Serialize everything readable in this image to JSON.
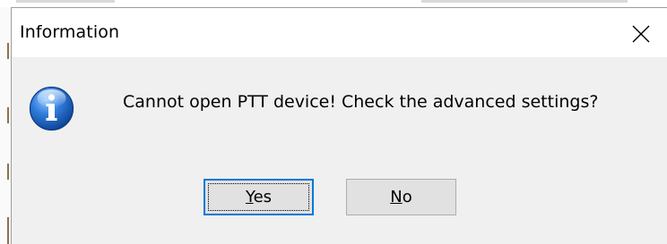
{
  "dialog": {
    "title": "Information",
    "message": "Cannot open PTT device! Check the advanced settings?",
    "icon": "information-icon",
    "buttons": {
      "yes": {
        "mnemonic": "Y",
        "rest": "es"
      },
      "no": {
        "mnemonic": "N",
        "rest": "o"
      }
    },
    "default_button": "yes"
  },
  "colors": {
    "titlebar": "#ffffff",
    "content": "#f0f0f0",
    "button_face": "#e1e1e1",
    "default_button_border": "#0078d7",
    "icon_blue": "#1a5fb4"
  }
}
